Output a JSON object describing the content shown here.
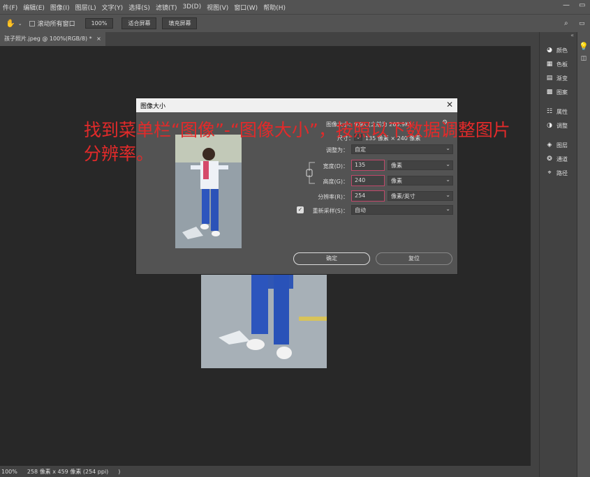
{
  "menu": [
    "件(F)",
    "编辑(E)",
    "图像(I)",
    "图层(L)",
    "文字(Y)",
    "选择(S)",
    "滤镜(T)",
    "3D(D)",
    "视图(V)",
    "窗口(W)",
    "帮助(H)"
  ],
  "options": {
    "scroll_all": "滚动所有窗口",
    "zoom": "100%",
    "fit_screen": "适合屏幕",
    "fill_screen": "填充屏幕"
  },
  "tab": {
    "title": "孩子照片.jpeg @ 100%(RGB/8) *",
    "close": "×"
  },
  "panels": [
    {
      "icon": "color-icon",
      "glyph": "◕",
      "label": "颜色"
    },
    {
      "icon": "swatches-icon",
      "glyph": "▦",
      "label": "色板"
    },
    {
      "icon": "gradient-icon",
      "glyph": "▤",
      "label": "渐变"
    },
    {
      "icon": "pattern-icon",
      "glyph": "▩",
      "label": "图案"
    },
    {
      "icon": "properties-icon",
      "glyph": "☷",
      "label": "属性"
    },
    {
      "icon": "adjustments-icon",
      "glyph": "◑",
      "label": "调整"
    },
    {
      "icon": "layers-icon",
      "glyph": "◈",
      "label": "图层"
    },
    {
      "icon": "channels-icon",
      "glyph": "❂",
      "label": "通道"
    },
    {
      "icon": "paths-icon",
      "glyph": "⌖",
      "label": "路径"
    }
  ],
  "status": {
    "zoom": "100%",
    "info": "258 像素 x 459 像素 (254 ppi)",
    "arrow": ")"
  },
  "dialog": {
    "title": "图像大小",
    "image_size_label": "图像大小：",
    "image_size_value": "9.9K (之前为 265.9K)",
    "dimensions_label": "尺寸：",
    "dimensions_value": "135 像素 × 240 像素",
    "fit_label": "调整为：",
    "fit_value": "自定",
    "width_label": "宽度(D)：",
    "width_value": "135",
    "width_unit": "像素",
    "height_label": "高度(G)：",
    "height_value": "240",
    "height_unit": "像素",
    "res_label": "分辨率(R)：",
    "res_value": "254",
    "res_unit": "像素/英寸",
    "resample_label": "重新采样(S)：",
    "resample_value": "自动",
    "ok": "确定",
    "reset": "复位"
  },
  "overlay_text": "找到菜单栏“图像”-“图像大小”，按照以下数据调整图片分辨率。"
}
